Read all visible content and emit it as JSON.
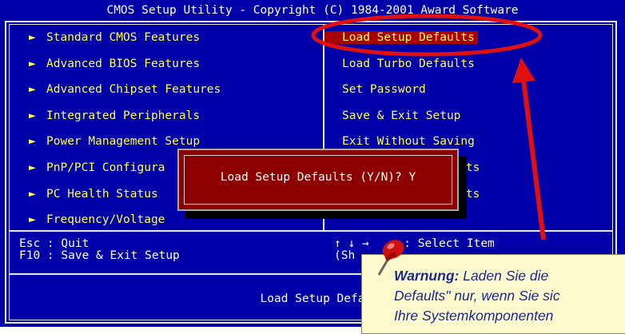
{
  "title": "CMOS Setup Utility - Copyright (C) 1984-2001 Award Software",
  "left_menu": [
    {
      "label": "Standard CMOS Features"
    },
    {
      "label": "Advanced BIOS Features"
    },
    {
      "label": "Advanced Chipset Features"
    },
    {
      "label": "Integrated Peripherals"
    },
    {
      "label": "Power Management Setup"
    },
    {
      "label": "PnP/PCI Configura"
    },
    {
      "label": "PC Health Status"
    },
    {
      "label": "Frequency/Voltage"
    }
  ],
  "right_menu": [
    {
      "label": "Load Setup Defaults"
    },
    {
      "label": "Load Turbo Defaults"
    },
    {
      "label": "Set Password"
    },
    {
      "label": "Save & Exit Setup"
    },
    {
      "label": "Exit Without Saving"
    },
    {
      "label": "faults"
    },
    {
      "label": "faults"
    }
  ],
  "arrow_glyph": "►",
  "help": {
    "left_line1": "Esc : Quit",
    "left_line2": "F10 : Save & Exit Setup",
    "right_line1": "↑ ↓ →     : Select Item",
    "right_line2": "(Sh"
  },
  "status_line": "Load Setup Defa",
  "dialog": {
    "prompt": "Load Setup Defaults (Y/N)? Y"
  },
  "note": {
    "bold": "Warnung:",
    "line1": " Laden Sie die",
    "line2": "Defaults\" nur, wenn Sie sic",
    "line3": "Ihre Systemkomponenten"
  },
  "colors": {
    "bios_background": "#0000a8",
    "menu_text": "#ffff55",
    "selection": "#a80000",
    "dialog_background": "#8c0000",
    "annotation_red": "#e01010",
    "note_background": "#fffacd",
    "note_text": "#1a2a8a"
  }
}
